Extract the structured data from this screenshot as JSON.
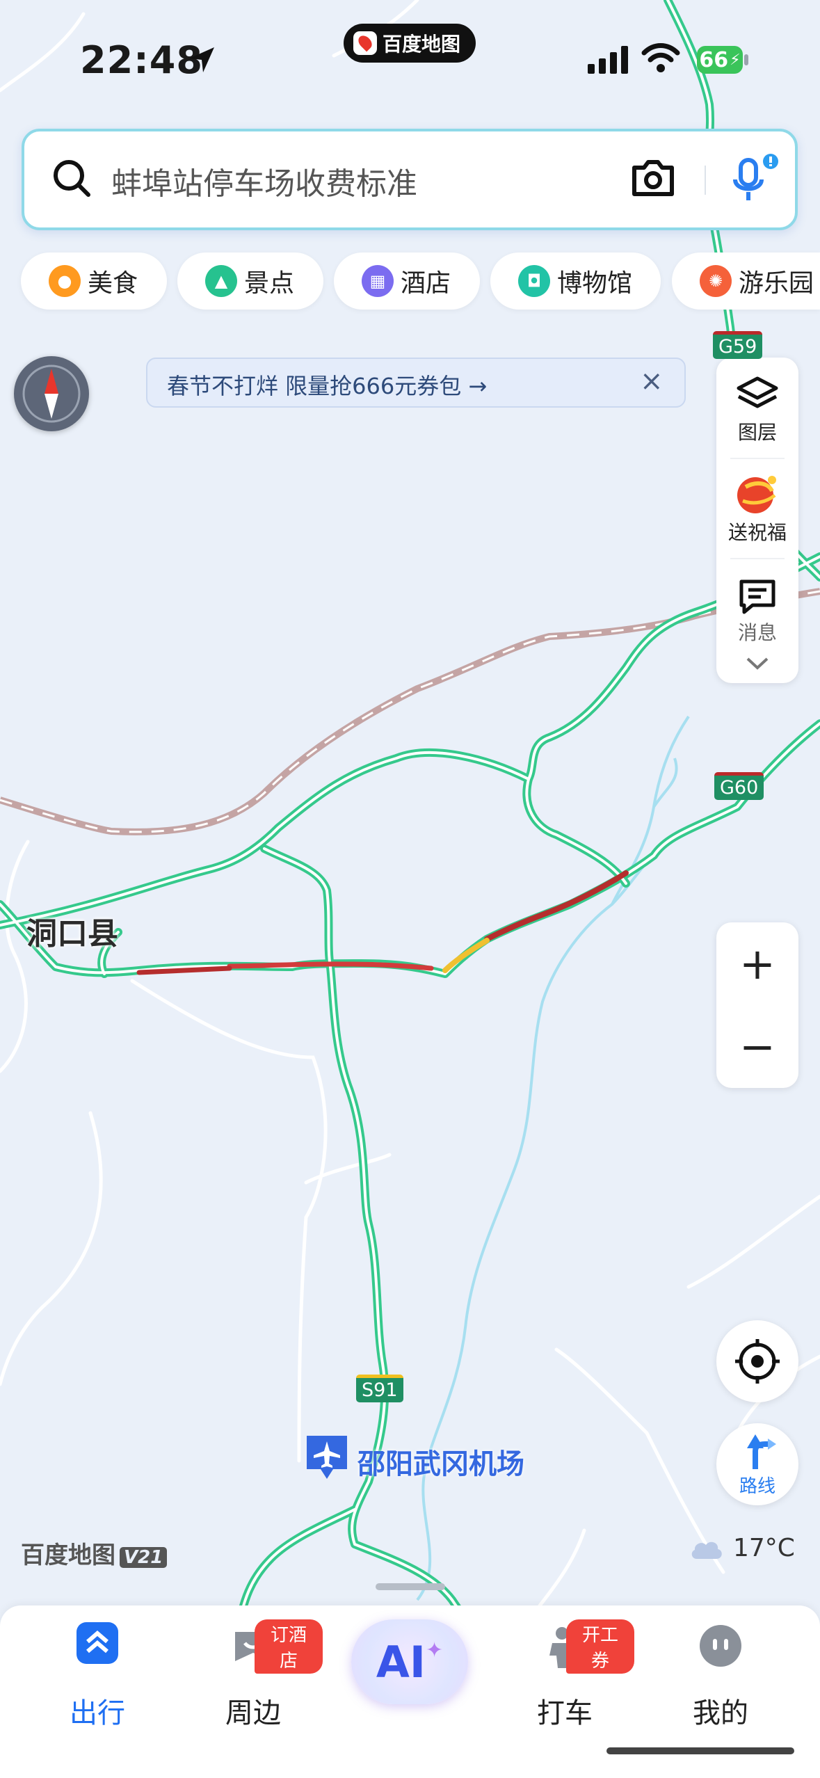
{
  "status_bar": {
    "time": "22:48",
    "app_name": "百度地图",
    "battery": "66"
  },
  "search": {
    "placeholder": "蚌埠站停车场收费标准"
  },
  "categories": [
    {
      "label": "美食",
      "color": "#ff9a1f",
      "icon": "food-icon"
    },
    {
      "label": "景点",
      "color": "#26c28f",
      "icon": "scenic-icon"
    },
    {
      "label": "酒店",
      "color": "#7b6cf0",
      "icon": "hotel-icon"
    },
    {
      "label": "博物馆",
      "color": "#22c3a6",
      "icon": "museum-icon"
    },
    {
      "label": "游乐园",
      "color": "#f5613a",
      "icon": "amusement-park-icon"
    }
  ],
  "promo": {
    "text": "春节不打烊 限量抢666元券包 →",
    "close": "×"
  },
  "right_panel": {
    "layers": "图层",
    "blessing": "送祝福",
    "messages": "消息"
  },
  "map": {
    "place": "洞口县",
    "airport": "邵阳武冈机场",
    "shields": [
      "G59",
      "G60",
      "S91"
    ],
    "brand": "百度地图",
    "version": "V21",
    "temperature": "17°C"
  },
  "controls": {
    "zoom_in": "+",
    "zoom_out": "−",
    "route": "路线"
  },
  "nav": {
    "items": [
      {
        "label": "出行",
        "active": true
      },
      {
        "label": "周边",
        "badge": "订酒店"
      },
      {
        "label": "AI"
      },
      {
        "label": "打车",
        "badge": "开工券"
      },
      {
        "label": "我的"
      }
    ]
  },
  "colors": {
    "accent": "#1a73e8",
    "road": "#35c98c",
    "congestion": "#d23b3b"
  }
}
